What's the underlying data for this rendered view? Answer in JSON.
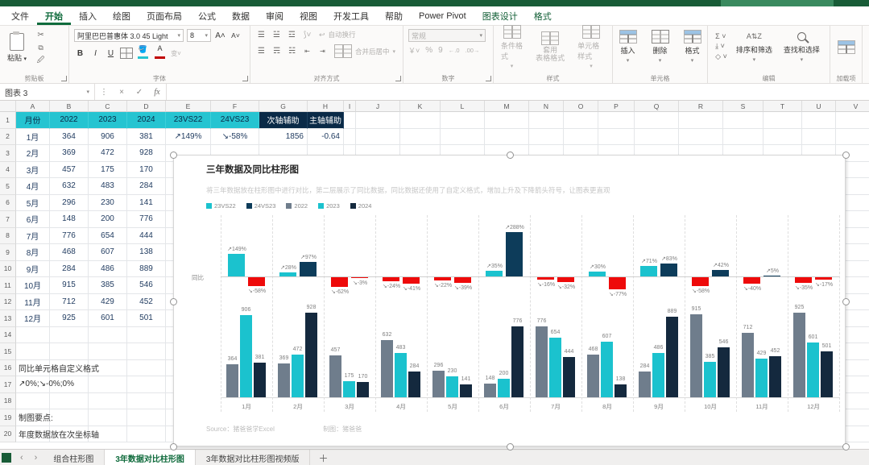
{
  "menu": {
    "tabs": [
      "文件",
      "开始",
      "插入",
      "绘图",
      "页面布局",
      "公式",
      "数据",
      "审阅",
      "视图",
      "开发工具",
      "帮助",
      "Power Pivot",
      "图表设计",
      "格式"
    ],
    "active": "开始",
    "contextual": [
      "图表设计",
      "格式"
    ]
  },
  "ribbon": {
    "groups": [
      "剪贴板",
      "字体",
      "对齐方式",
      "数字",
      "样式",
      "单元格",
      "编辑",
      "加载项"
    ],
    "paste_label": "粘贴",
    "font_name": "阿里巴巴普惠体 3.0 45 Light",
    "font_size": "8",
    "bold": "B",
    "italic": "I",
    "underline": "U",
    "wrap_label": "自动换行",
    "merge_label": "合并后居中",
    "number_format": "常规",
    "percent": "%",
    "comma": "9",
    "styles": {
      "conditional": "条件格式",
      "table": "套用\n表格格式",
      "cell": "单元格样式"
    },
    "cells": {
      "insert": "插入",
      "del": "删除",
      "format": "格式"
    },
    "editing": {
      "sort": "排序和筛选",
      "find": "查找和选择"
    }
  },
  "formula_bar": {
    "name_box": "图表 3",
    "fx": "fx"
  },
  "icons": {
    "dropdown": "▾",
    "dots": "⋮",
    "cancel": "×",
    "enter": "✓",
    "cut": "✂",
    "sum": "Σ",
    "prev": "‹",
    "next": "›",
    "add_sheet": "＋",
    "arrow_up": "↗",
    "arrow_down": "↘"
  },
  "grid": {
    "columns": [
      "A",
      "B",
      "C",
      "D",
      "E",
      "F",
      "G",
      "H",
      "I",
      "J",
      "K",
      "L",
      "M",
      "N",
      "O",
      "P",
      "Q",
      "R",
      "S",
      "T",
      "U",
      "V"
    ],
    "cells": {
      "A1": "月份",
      "B1": "2022",
      "C1": "2023",
      "D1": "2024",
      "E1": "23VS22",
      "F1": "24VS23",
      "G1": "次轴辅助",
      "H1": "主轴辅助",
      "A2": "1月",
      "B2": "364",
      "C2": "906",
      "D2": "381",
      "E2": "↗149%",
      "F2": "↘-58%",
      "G2": "1856",
      "H2": "-0.64",
      "A3": "2月",
      "B3": "369",
      "C3": "472",
      "D3": "928",
      "A4": "3月",
      "B4": "457",
      "C4": "175",
      "D4": "170",
      "A5": "4月",
      "B5": "632",
      "C5": "483",
      "D5": "284",
      "A6": "5月",
      "B6": "296",
      "C6": "230",
      "D6": "141",
      "A7": "6月",
      "B7": "148",
      "C7": "200",
      "D7": "776",
      "A8": "7月",
      "B8": "776",
      "C8": "654",
      "D8": "444",
      "A9": "8月",
      "B9": "468",
      "C9": "607",
      "D9": "138",
      "A10": "9月",
      "B10": "284",
      "C10": "486",
      "D10": "889",
      "A11": "10月",
      "B11": "915",
      "C11": "385",
      "D11": "546",
      "A12": "11月",
      "B12": "712",
      "C12": "429",
      "D12": "452",
      "A13": "12月",
      "B13": "925",
      "C13": "601",
      "D13": "501",
      "A16": "同比单元格自定义格式",
      "A17": "↗0%;↘-0%;0%",
      "A19": "制图要点:",
      "A20": "年度数据放在次坐标轴"
    }
  },
  "chart_data": {
    "type": "bar",
    "title": "三年数据及同比柱形图",
    "subtitle": "将三年数据放在柱形图中进行对比，第二层展示了同比数据，同比数据还使用了自定义格式，增加上升及下降箭头符号，让图表更直观",
    "categories": [
      "1月",
      "2月",
      "3月",
      "4月",
      "5月",
      "6月",
      "7月",
      "8月",
      "9月",
      "10月",
      "11月",
      "12月"
    ],
    "series": [
      {
        "name": "2022",
        "color": "#6f7d8c",
        "values": [
          364,
          369,
          457,
          632,
          296,
          148,
          776,
          468,
          284,
          915,
          712,
          925
        ]
      },
      {
        "name": "2023",
        "color": "#1bc2ce",
        "values": [
          906,
          472,
          175,
          483,
          230,
          200,
          654,
          607,
          486,
          385,
          429,
          601
        ]
      },
      {
        "name": "2024",
        "color": "#14293e",
        "values": [
          381,
          928,
          170,
          284,
          141,
          776,
          444,
          138,
          889,
          546,
          452,
          501
        ]
      }
    ],
    "yoy": {
      "axis_label": "同比",
      "series": [
        {
          "name": "23VS22",
          "color": "#1bc2ce",
          "values": [
            149,
            28,
            -62,
            -24,
            -22,
            35,
            -16,
            30,
            71,
            -58,
            -40,
            -35
          ]
        },
        {
          "name": "24VS23",
          "color": "#0d3c5a",
          "values": [
            -58,
            97,
            -3,
            -41,
            -39,
            288,
            -32,
            -77,
            83,
            42,
            5,
            -17
          ]
        }
      ],
      "negative_color": "#ee0a0a",
      "label_format": "↗0%;↘-0%;0%"
    },
    "legend": [
      {
        "label": "23VS22",
        "color": "#1bc2ce"
      },
      {
        "label": "24VS23",
        "color": "#0d3c5a"
      },
      {
        "label": "2022",
        "color": "#6f7d8c"
      },
      {
        "label": "2023",
        "color": "#1bc2ce"
      },
      {
        "label": "2024",
        "color": "#14293e"
      }
    ],
    "source": "Source：猪爸爸学Excel",
    "credit": "制图：猪爸爸",
    "grid_lines": false,
    "value_labels": true,
    "ylim_main": [
      0,
      1000
    ],
    "ylim_yoy": [
      -100,
      300
    ]
  },
  "sheet_tabs": {
    "items": [
      "组合柱形图",
      "3年数据对比柱形图",
      "3年数据对比柱形图视频版"
    ],
    "active": "3年数据对比柱形图"
  },
  "colors": {
    "excel_green": "#185c37",
    "header_cyan": "#26c4d1",
    "header_navy": "#0a2a47",
    "accent_red": "#c00000"
  }
}
